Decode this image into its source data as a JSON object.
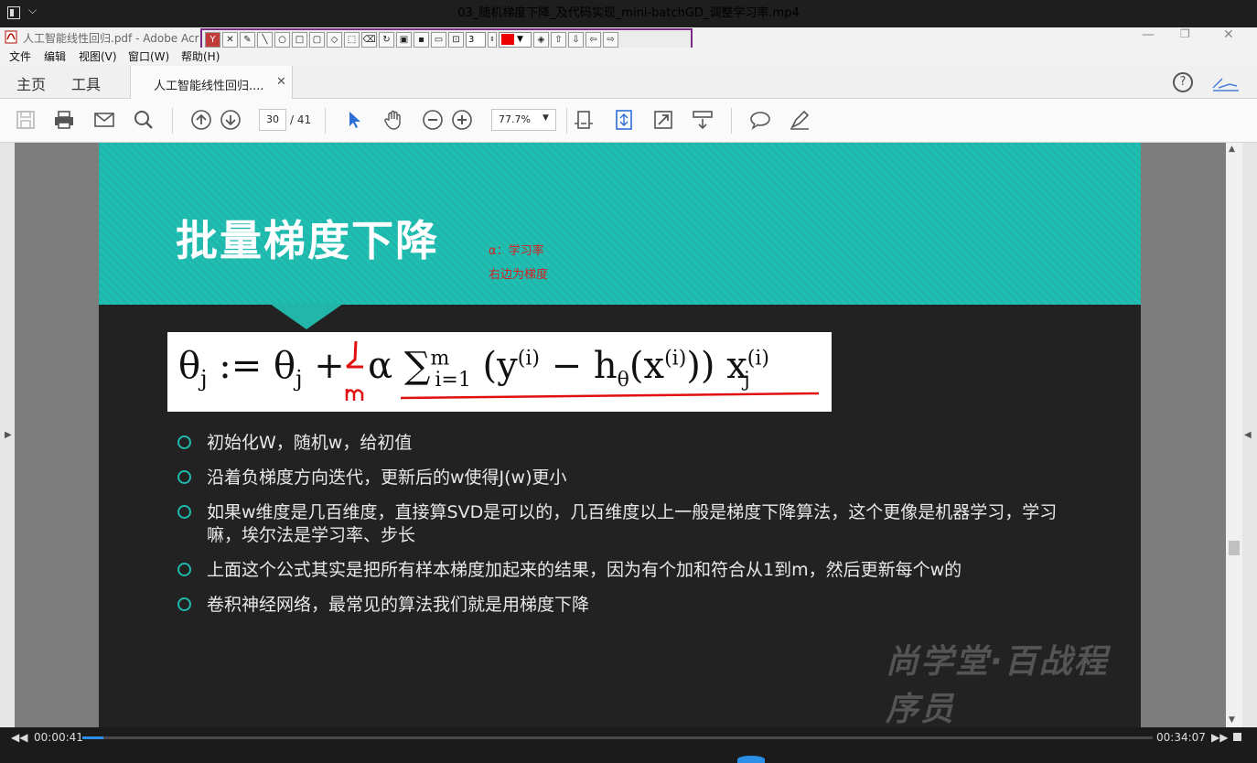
{
  "player": {
    "title": "03_随机梯度下降_及代码实现_mini-batchGD_调整学习率.mp4",
    "time_current": "00:00:41",
    "time_total": "00:34:07",
    "progress": 0.02
  },
  "acrobat": {
    "window_title": "人工智能线性回归.pdf - Adobe Acr",
    "menu": [
      "文件",
      "编辑",
      "视图(V)",
      "窗口(W)",
      "帮助(H)"
    ],
    "tabs": {
      "home": "主页",
      "tools": "工具",
      "doc": "人工智能线性回归...."
    },
    "page_current": "30",
    "page_total": "/ 41",
    "zoom": "77.7%",
    "annotation_line_width": "3",
    "annotation_color": "#e00000"
  },
  "slide": {
    "title": "批量梯度下降",
    "note_alpha": "α：学习率",
    "note_gradient": "右边为梯度",
    "formula": "θj := θj + α Σ(i=1..m) (y(i) − hθ(x(i))) xj(i)",
    "bullets": [
      "初始化W，随机w，给初值",
      "沿着负梯度方向迭代，更新后的w使得J(w)更小",
      "如果w维度是几百维度，直接算SVD是可以的，几百维度以上一般是梯度下降算法，这个更像是机器学习，学习嘛，埃尔法是学习率、步长",
      "上面这个公式其实是把所有样本梯度加起来的结果，因为有个加和符合从1到m，然后更新每个w的",
      "卷积神经网络，最常见的算法我们就是用梯度下降"
    ],
    "watermark": "尚学堂·百战程序员",
    "accent_color": "#1fc0b4"
  }
}
